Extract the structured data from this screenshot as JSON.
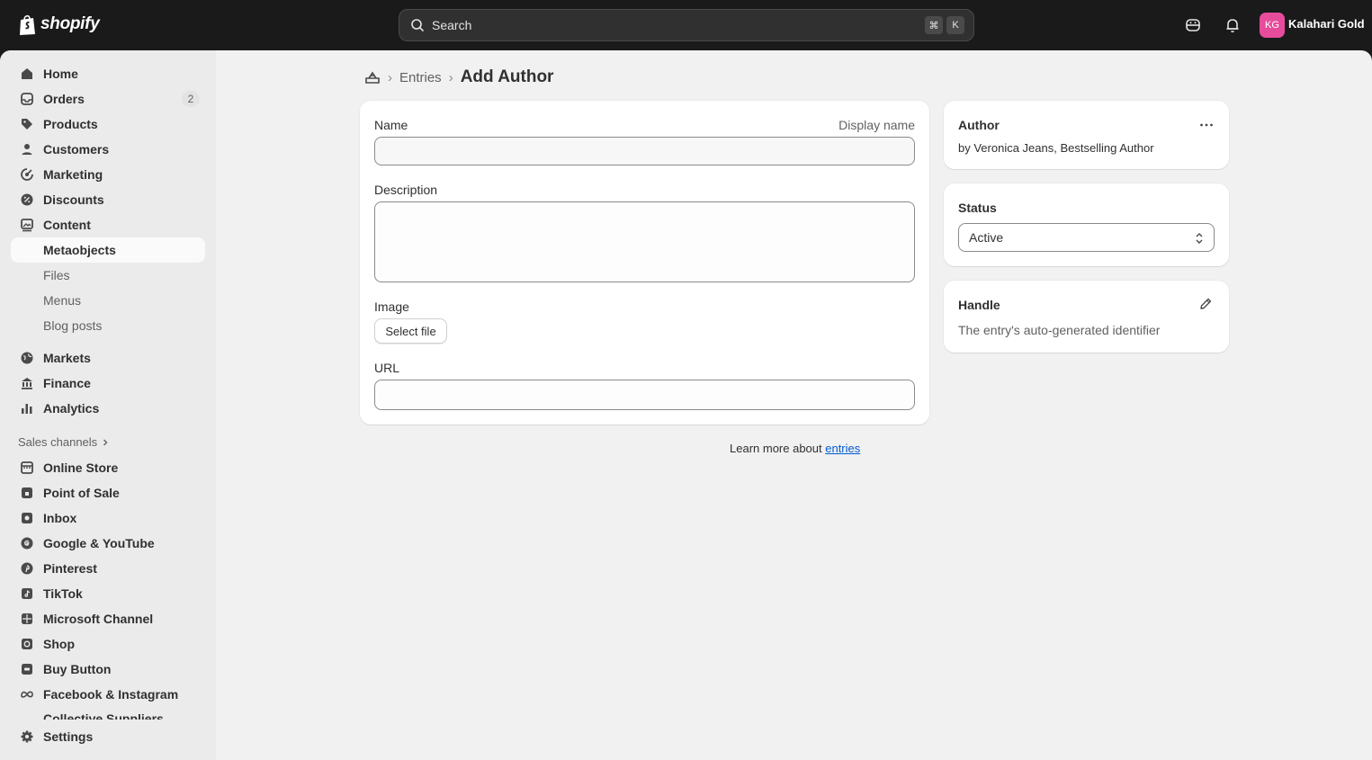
{
  "topbar": {
    "brand": "shopify",
    "search_placeholder": "Search",
    "kbd_cmd": "⌘",
    "kbd_key": "K",
    "avatar_initials": "KG",
    "store_name": "Kalahari Gold",
    "avatar_color": "#e74c9c"
  },
  "sidebar": {
    "home": "Home",
    "orders": "Orders",
    "orders_badge": "2",
    "products": "Products",
    "customers": "Customers",
    "marketing": "Marketing",
    "discounts": "Discounts",
    "content": "Content",
    "metaobjects": "Metaobjects",
    "files": "Files",
    "menus": "Menus",
    "blog_posts": "Blog posts",
    "markets": "Markets",
    "finance": "Finance",
    "analytics": "Analytics",
    "sales_channels": "Sales channels",
    "online_store": "Online Store",
    "point_of_sale": "Point of Sale",
    "inbox": "Inbox",
    "google_youtube": "Google & YouTube",
    "pinterest": "Pinterest",
    "tiktok": "TikTok",
    "microsoft": "Microsoft Channel",
    "shop": "Shop",
    "buy_button": "Buy Button",
    "facebook": "Facebook & Instagram",
    "collective": "Collective Suppliers",
    "settings": "Settings"
  },
  "breadcrumb": {
    "entries": "Entries",
    "title": "Add Author"
  },
  "form": {
    "name_label": "Name",
    "name_hint": "Display name",
    "name_value": "",
    "description_label": "Description",
    "description_value": "",
    "image_label": "Image",
    "select_file": "Select file",
    "url_label": "URL",
    "url_value": ""
  },
  "learn": {
    "text": "Learn more about ",
    "link": "entries"
  },
  "author_card": {
    "title": "Author",
    "subtitle": "by Veronica Jeans, Bestselling Author"
  },
  "status_card": {
    "title": "Status",
    "value": "Active"
  },
  "handle_card": {
    "title": "Handle",
    "text": "The entry's auto-generated identifier"
  },
  "colors": {
    "link": "#005bd3",
    "topbar": "#1a1a1a"
  }
}
